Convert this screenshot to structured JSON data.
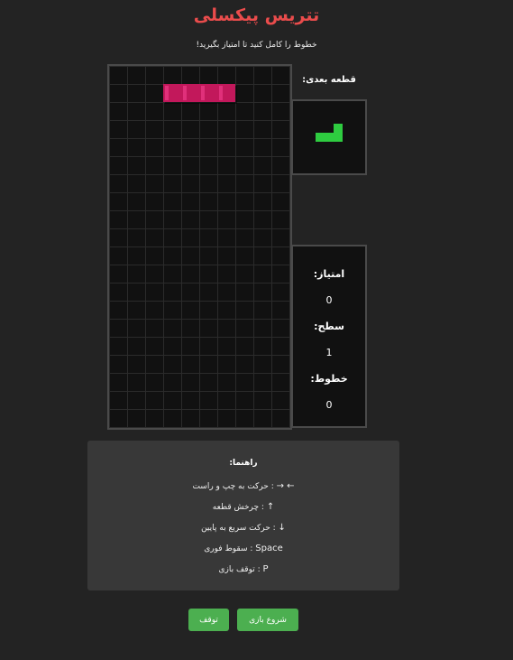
{
  "header": {
    "title": "تتریس پیکسلی",
    "subtitle": "خطوط را کامل کنید تا امتیاز بگیرید!"
  },
  "board": {
    "columns": 10,
    "rows": 20,
    "current_piece": {
      "type": "I",
      "color": "#c2185b",
      "cells": [
        [
          3,
          1
        ],
        [
          4,
          1
        ],
        [
          5,
          1
        ],
        [
          6,
          1
        ]
      ]
    }
  },
  "next_piece": {
    "label": "قطعه بعدی:",
    "type": "L",
    "color": "#2ecc40"
  },
  "stats": {
    "score_label": "امتیاز:",
    "score": "0",
    "level_label": "سطح:",
    "level": "1",
    "lines_label": "خطوط:",
    "lines": "0"
  },
  "help": {
    "title": "راهنما:",
    "lines": [
      {
        "key": "← →",
        "text": " : حرکت به چپ و راست"
      },
      {
        "key": "↑",
        "text": " : چرخش قطعه"
      },
      {
        "key": "↓",
        "text": " : حرکت سریع به پایین"
      },
      {
        "key": "Space",
        "text": " : سقوط فوری"
      },
      {
        "key": "P",
        "text": " : توقف بازی"
      }
    ]
  },
  "buttons": {
    "start": "شروع بازی",
    "pause": "توقف"
  },
  "colors": {
    "title": "#ea4c4c",
    "button": "#4caf50",
    "background": "#232323"
  }
}
